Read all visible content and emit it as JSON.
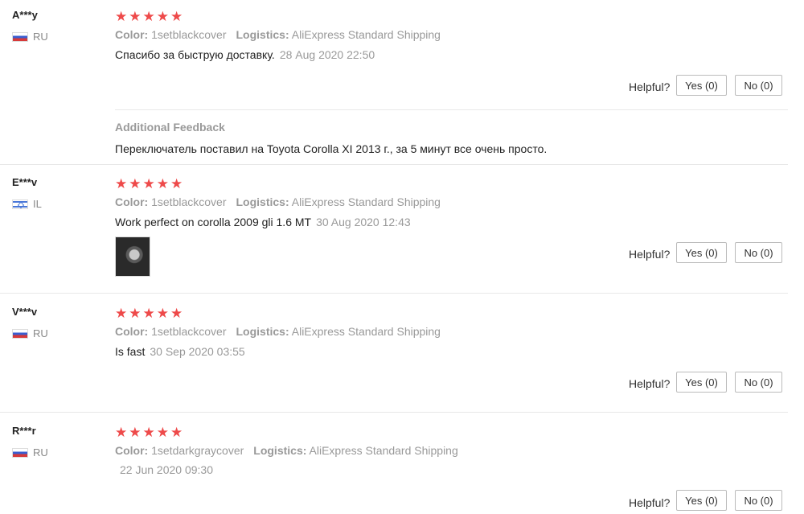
{
  "labels": {
    "color": "Color:",
    "logistics": "Logistics:",
    "helpful": "Helpful?",
    "additional_feedback": "Additional Feedback"
  },
  "star_color": "#ee4a4a",
  "reviews": [
    {
      "user": "A***y",
      "country": "RU",
      "rating": 5,
      "color_value": "1setblackcover",
      "logistics_value": "AliExpress Standard Shipping",
      "text": "Спасибо за быструю доставку.",
      "date": "28 Aug 2020 22:50",
      "yes": "Yes (0)",
      "no": "No (0)",
      "additional_text": "Переключатель поставил на Toyota Corolla XI 2013 г., за 5 минут все очень просто."
    },
    {
      "user": "E***v",
      "country": "IL",
      "rating": 5,
      "color_value": "1setblackcover",
      "logistics_value": "AliExpress Standard Shipping",
      "text": "Work perfect on corolla 2009 gli 1.6 MT",
      "date": "30 Aug 2020 12:43",
      "yes": "Yes (0)",
      "no": "No (0)"
    },
    {
      "user": "V***v",
      "country": "RU",
      "rating": 5,
      "color_value": "1setblackcover",
      "logistics_value": "AliExpress Standard Shipping",
      "text": "Is fast",
      "date": "30 Sep 2020 03:55",
      "yes": "Yes (0)",
      "no": "No (0)"
    },
    {
      "user": "R***r",
      "country": "RU",
      "rating": 5,
      "color_value": "1setdarkgraycover",
      "logistics_value": "AliExpress Standard Shipping",
      "text": "",
      "date": "22 Jun 2020 09:30",
      "yes": "Yes (0)",
      "no": "No (0)"
    }
  ]
}
